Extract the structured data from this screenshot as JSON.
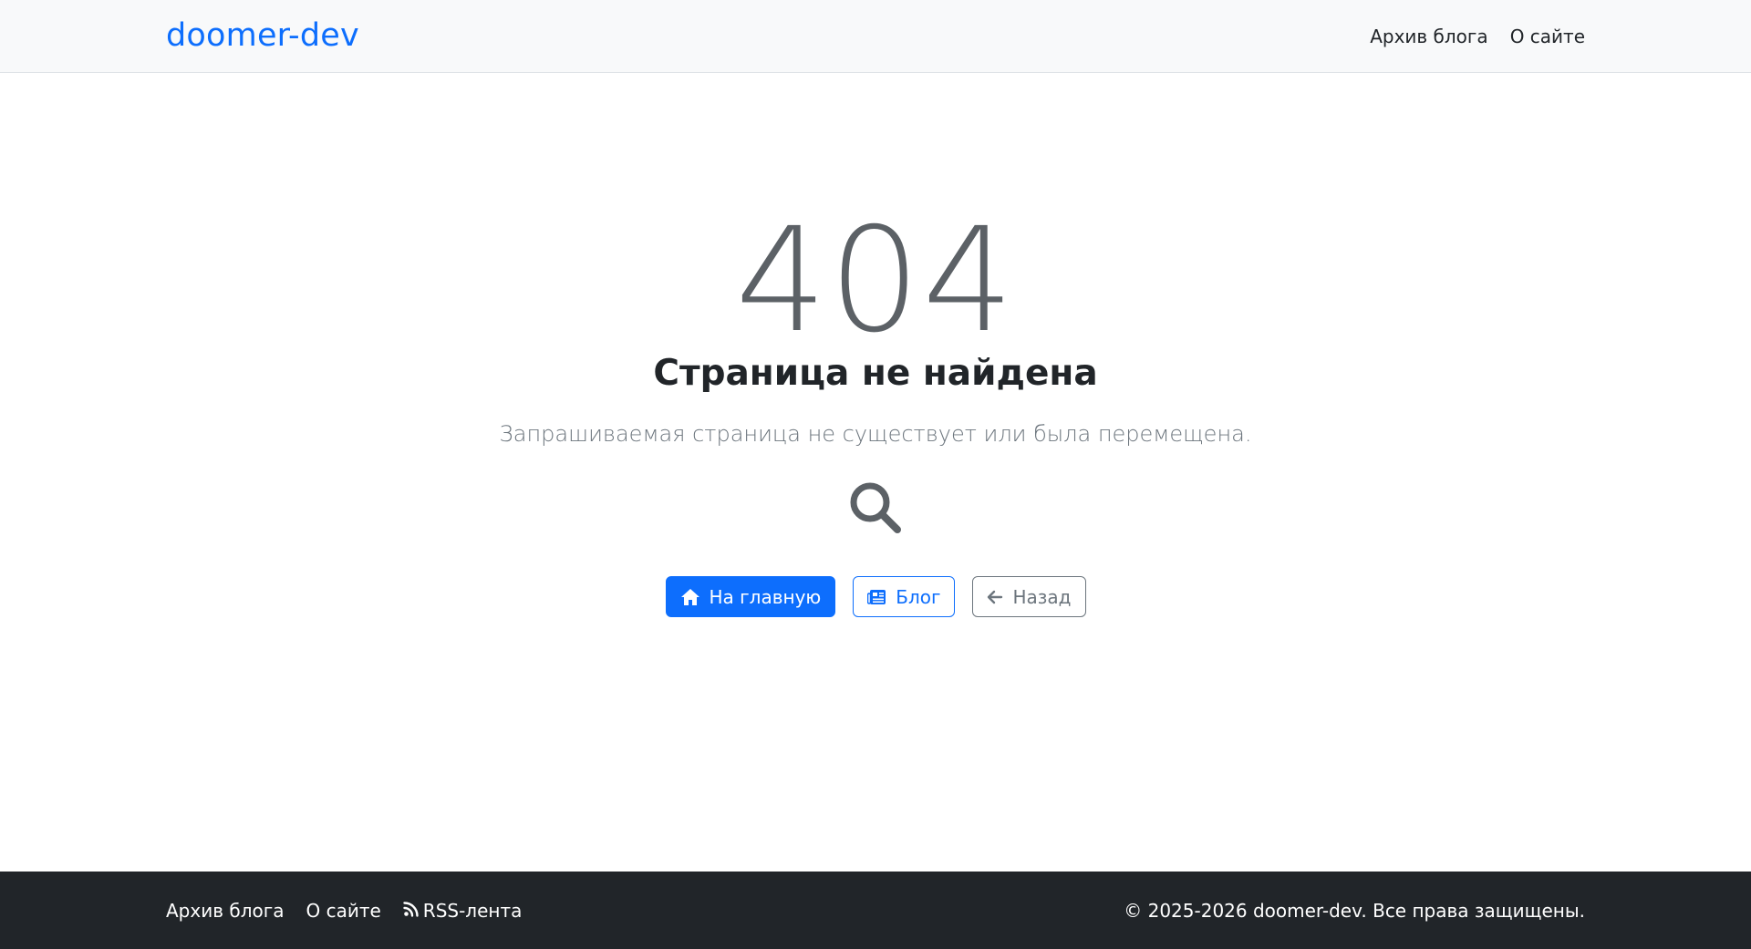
{
  "header": {
    "brand": "doomer-dev",
    "nav": [
      {
        "label": "Архив блога"
      },
      {
        "label": "О сайте"
      }
    ]
  },
  "error": {
    "code": "404",
    "title": "Страница не найдена",
    "message": "Запрашиваемая страница не существует или была перемещена.",
    "icon": "search-icon"
  },
  "actions": {
    "home": {
      "label": "На главную",
      "icon": "home-icon"
    },
    "blog": {
      "label": "Блог",
      "icon": "newspaper-icon"
    },
    "back": {
      "label": "Назад",
      "icon": "arrow-left-icon"
    }
  },
  "footer": {
    "links": [
      {
        "label": "Архив блога"
      },
      {
        "label": "О сайте"
      },
      {
        "label": "RSS-лента",
        "icon": "rss-icon"
      }
    ],
    "copyright": "© 2025-2026 doomer-dev. Все права защищены."
  },
  "colors": {
    "primary": "#0d6efd",
    "secondary": "#6c757d",
    "footer_bg": "#212529",
    "navbar_bg": "#f8f9fa",
    "error_code": "#5c6166"
  }
}
